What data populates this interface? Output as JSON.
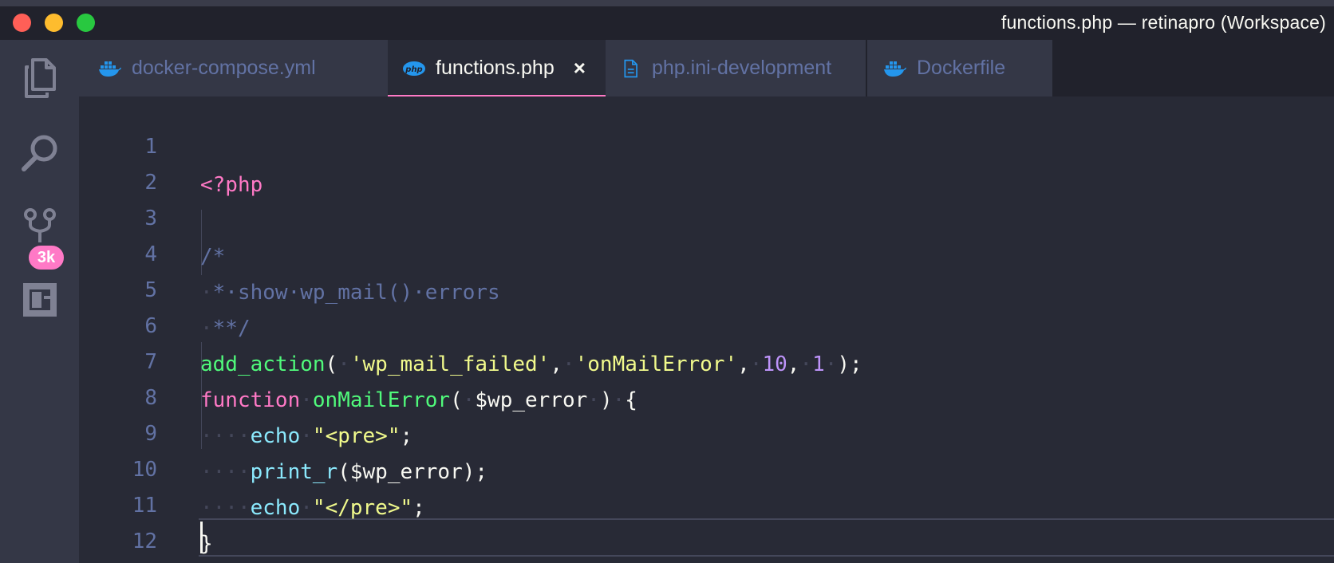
{
  "window": {
    "title": "functions.php — retinapro (Workspace)"
  },
  "activity_bar": {
    "scm_badge": "3k",
    "items": [
      "explorer",
      "search",
      "source-control",
      "extensions"
    ]
  },
  "tabs": [
    {
      "label": "docker-compose.yml",
      "icon": "docker-icon",
      "active": false
    },
    {
      "label": "functions.php",
      "icon": "php-icon",
      "active": true,
      "close": "×"
    },
    {
      "label": "php.ini-development",
      "icon": "file-icon",
      "active": false
    },
    {
      "label": "Dockerfile",
      "icon": "docker-icon",
      "active": false
    }
  ],
  "editor": {
    "line_numbers": [
      "1",
      "2",
      "3",
      "4",
      "5",
      "6",
      "7",
      "8",
      "9",
      "10",
      "11",
      "12"
    ],
    "lines": {
      "l1": {
        "open_tag": "<?php"
      },
      "l3": {
        "comment": "/*"
      },
      "l4": {
        "ws": "·",
        "comment": "*·show·wp_mail()·errors"
      },
      "l5": {
        "ws": "·",
        "comment": "**/"
      },
      "l6": {
        "func": "add_action",
        "p1": "(",
        "s1": "·",
        "str1": "'wp_mail_failed'",
        "c1": ",",
        "s2": "·",
        "str2": "'onMailError'",
        "c2": ",",
        "s3": "·",
        "n1": "10",
        "c3": ",",
        "s4": "·",
        "n2": "1",
        "s5": "·",
        "end": ");"
      },
      "l7": {
        "kw": "function",
        "s1": "·",
        "fname": "onMailError",
        "p1": "(",
        "s2": "·",
        "var": "$wp_error",
        "s3": "·",
        "p2": ")",
        "s4": "·",
        "brace": "{"
      },
      "l8": {
        "ws": "····",
        "fn": "echo",
        "s1": "·",
        "q1": "\"",
        "str": "<pre>",
        "q2": "\"",
        "end": ";"
      },
      "l9": {
        "ws": "····",
        "fn": "print_r",
        "rest": "($wp_error);"
      },
      "l10": {
        "ws": "····",
        "fn": "echo",
        "s1": "·",
        "q1": "\"",
        "str": "</pre>",
        "q2": "\"",
        "end": ";"
      },
      "l11": {
        "brace": "}"
      }
    }
  },
  "colors": {
    "background": "#282a36",
    "keyword": "#ff79c6",
    "function": "#50fa7b",
    "string": "#f1fa8c",
    "number": "#bd93f9",
    "builtin": "#8be9fd",
    "comment": "#6272a4"
  }
}
